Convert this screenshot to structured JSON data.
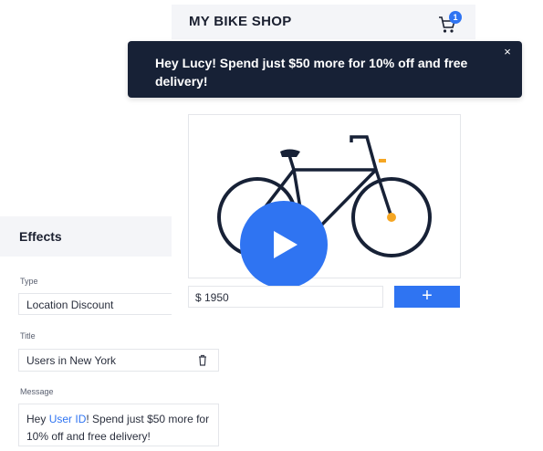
{
  "shop": {
    "title": "MY BIKE SHOP",
    "cart_count": "1",
    "price": "$ 1950",
    "add_label": "+"
  },
  "toast": {
    "message": "Hey Lucy! Spend just $50 more for 10% off and free delivery!",
    "close": "×"
  },
  "effects": {
    "title": "Effects",
    "type_label": "Type",
    "type_value": "Location Discount",
    "title_label": "Title",
    "title_value": "Users in New York",
    "message_label": "Message",
    "message_prefix": "Hey ",
    "message_token": "User ID",
    "message_suffix": "! Spend just $50 more for 10% off and free delivery!"
  },
  "colors": {
    "accent": "#2f74f2",
    "toast_bg": "#172136",
    "bike_frame": "#172136",
    "bike_hub": "#f5a623"
  },
  "icons": [
    "cart-icon",
    "close-icon",
    "play-icon",
    "trash-icon",
    "plus-icon"
  ]
}
